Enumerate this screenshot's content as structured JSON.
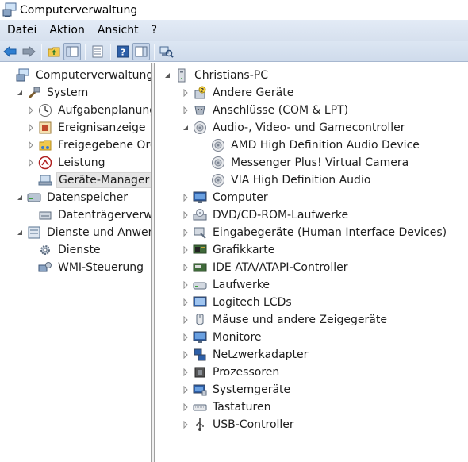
{
  "window": {
    "title": "Computerverwaltung"
  },
  "menu": [
    "Datei",
    "Aktion",
    "Ansicht",
    "?"
  ],
  "toolbar": {
    "buttons": [
      "back-arrow-icon",
      "forward-arrow-icon",
      "up-folder-icon",
      "show-hide-tree-icon",
      "properties-icon",
      "help-icon",
      "action-pane-icon",
      "scan-hardware-icon"
    ]
  },
  "left_tree": [
    {
      "label": "Computerverwaltung (Lo",
      "level": 0,
      "expander": "none",
      "icon": "computer-management-icon"
    },
    {
      "label": "System",
      "level": 1,
      "expander": "expanded",
      "icon": "tools-icon"
    },
    {
      "label": "Aufgabenplanung",
      "level": 2,
      "expander": "collapsed",
      "icon": "clock-icon"
    },
    {
      "label": "Ereignisanzeige",
      "level": 2,
      "expander": "collapsed",
      "icon": "event-viewer-icon"
    },
    {
      "label": "Freigegebene Ordr",
      "level": 2,
      "expander": "collapsed",
      "icon": "shared-folder-icon"
    },
    {
      "label": "Leistung",
      "level": 2,
      "expander": "collapsed",
      "icon": "performance-icon"
    },
    {
      "label": "Geräte-Manager",
      "level": 2,
      "expander": "none",
      "icon": "device-manager-icon",
      "selected": true
    },
    {
      "label": "Datenspeicher",
      "level": 1,
      "expander": "expanded",
      "icon": "storage-icon"
    },
    {
      "label": "Datenträgerverwalt",
      "level": 2,
      "expander": "none",
      "icon": "disk-management-icon"
    },
    {
      "label": "Dienste und Anwendu",
      "level": 1,
      "expander": "expanded",
      "icon": "services-apps-icon"
    },
    {
      "label": "Dienste",
      "level": 2,
      "expander": "none",
      "icon": "gear-icon"
    },
    {
      "label": "WMI-Steuerung",
      "level": 2,
      "expander": "none",
      "icon": "wmi-icon"
    }
  ],
  "device_tree": [
    {
      "label": "Christians-PC",
      "level": 0,
      "expander": "expanded",
      "icon": "computer-tower-icon"
    },
    {
      "label": "Andere Geräte",
      "level": 1,
      "expander": "collapsed",
      "icon": "unknown-device-icon"
    },
    {
      "label": "Anschlüsse (COM & LPT)",
      "level": 1,
      "expander": "collapsed",
      "icon": "port-icon"
    },
    {
      "label": "Audio-, Video- und Gamecontroller",
      "level": 1,
      "expander": "expanded",
      "icon": "speaker-icon"
    },
    {
      "label": "AMD High Definition Audio Device",
      "level": 2,
      "expander": "none",
      "icon": "speaker-icon"
    },
    {
      "label": "Messenger Plus! Virtual Camera",
      "level": 2,
      "expander": "none",
      "icon": "speaker-icon"
    },
    {
      "label": "VIA High Definition Audio",
      "level": 2,
      "expander": "none",
      "icon": "speaker-icon"
    },
    {
      "label": "Computer",
      "level": 1,
      "expander": "collapsed",
      "icon": "monitor-icon"
    },
    {
      "label": "DVD/CD-ROM-Laufwerke",
      "level": 1,
      "expander": "collapsed",
      "icon": "optical-drive-icon"
    },
    {
      "label": "Eingabegeräte (Human Interface Devices)",
      "level": 1,
      "expander": "collapsed",
      "icon": "hid-icon"
    },
    {
      "label": "Grafikkarte",
      "level": 1,
      "expander": "collapsed",
      "icon": "display-adapter-icon"
    },
    {
      "label": "IDE ATA/ATAPI-Controller",
      "level": 1,
      "expander": "collapsed",
      "icon": "ide-controller-icon"
    },
    {
      "label": "Laufwerke",
      "level": 1,
      "expander": "collapsed",
      "icon": "disk-drive-icon"
    },
    {
      "label": "Logitech LCDs",
      "level": 1,
      "expander": "collapsed",
      "icon": "lcd-icon"
    },
    {
      "label": "Mäuse und andere Zeigegeräte",
      "level": 1,
      "expander": "collapsed",
      "icon": "mouse-icon"
    },
    {
      "label": "Monitore",
      "level": 1,
      "expander": "collapsed",
      "icon": "monitor-icon"
    },
    {
      "label": "Netzwerkadapter",
      "level": 1,
      "expander": "collapsed",
      "icon": "network-adapter-icon"
    },
    {
      "label": "Prozessoren",
      "level": 1,
      "expander": "collapsed",
      "icon": "processor-icon"
    },
    {
      "label": "Systemgeräte",
      "level": 1,
      "expander": "collapsed",
      "icon": "system-device-icon"
    },
    {
      "label": "Tastaturen",
      "level": 1,
      "expander": "collapsed",
      "icon": "keyboard-icon"
    },
    {
      "label": "USB-Controller",
      "level": 1,
      "expander": "collapsed",
      "icon": "usb-icon"
    }
  ]
}
